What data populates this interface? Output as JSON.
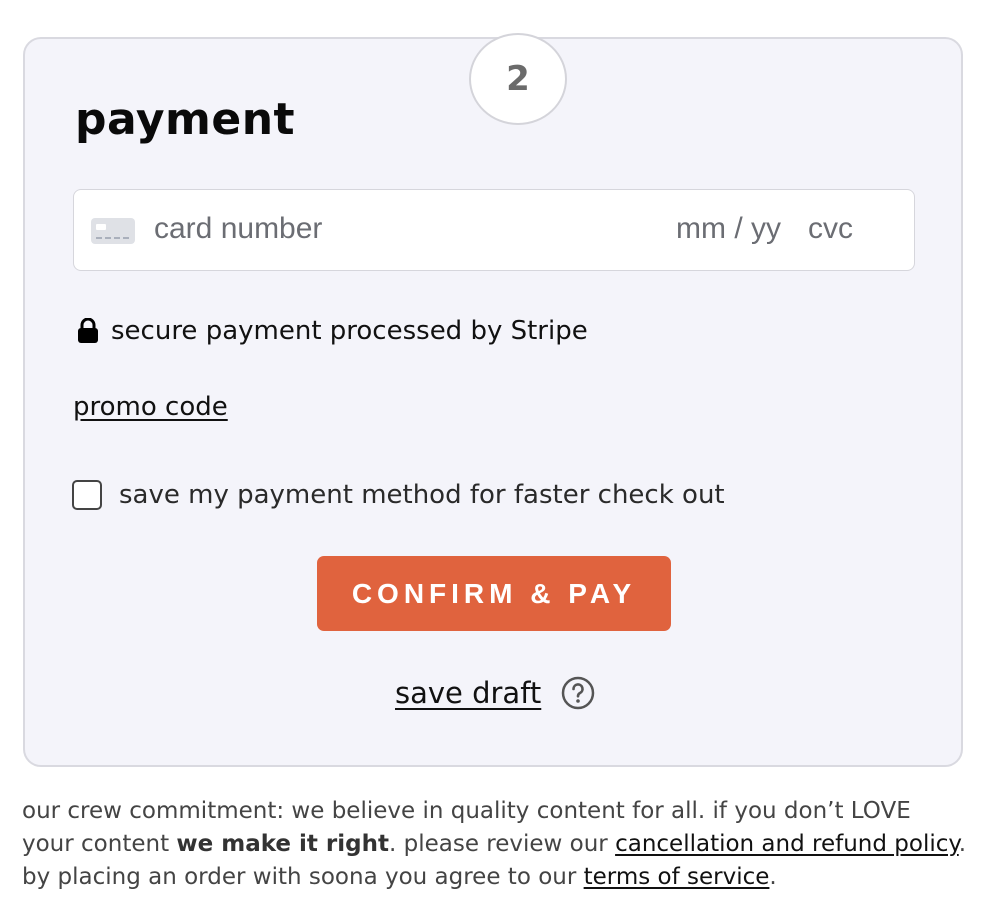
{
  "step": {
    "number": "2"
  },
  "payment": {
    "title": "payment",
    "card_field": {
      "card_number_placeholder": "card number",
      "expiry_placeholder": "mm / yy",
      "cvc_placeholder": "cvc"
    },
    "secure_text": "secure payment processed by Stripe",
    "promo_label": "promo code",
    "save_method_label": "save my payment method for faster check out",
    "save_method_checked": false,
    "confirm_label": "CONFIRM & PAY",
    "save_draft_label": "save draft"
  },
  "footer": {
    "part1": "our crew commitment: we believe in quality content for all. if you don’t LOVE your content ",
    "bold": "we make it right",
    "part2": ". please review our ",
    "refund_link": "cancellation and refund policy",
    "part3": ". by placing an order with soona you agree to our ",
    "terms_link": "terms of service",
    "part4": "."
  },
  "colors": {
    "accent": "#e0633e",
    "card_bg": "#f4f4fa",
    "border": "#d9d9e0"
  },
  "icons": {
    "lock": "lock-icon",
    "card": "credit-card-icon",
    "help": "question-circle-icon"
  }
}
